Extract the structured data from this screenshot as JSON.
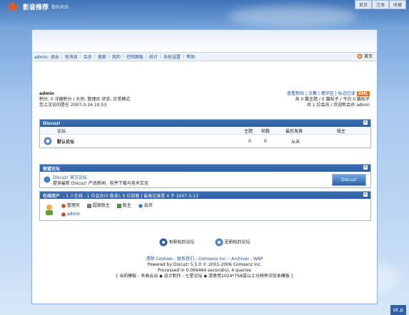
{
  "brand": {
    "title": "影音推荐",
    "subtitle": "数码风尚"
  },
  "top_links": [
    "首页",
    "注册",
    "收藏"
  ],
  "nav": {
    "items": [
      "admin: 退出",
      "短消息",
      "会员",
      "搜索",
      "我的",
      "控制面板",
      "统计",
      "系统设置",
      "帮助"
    ],
    "home": "首页"
  },
  "user": {
    "name": "admin",
    "line1": "积分: 0 详细积分 / 头衔: 管理员 状态: 正常模式",
    "line2": "您上次访问是在 2007-3-16 10:53"
  },
  "links": {
    "row1": "查看新帖 | 文集 | 精华区 | 标记已读",
    "rss": "XML",
    "row2": "共 0 篇主题 / 0 篇帖子 / 今日 0 篇帖子",
    "row3": "共 1 位会员 / 欢迎新会员 admin"
  },
  "forum_box": {
    "title": "Discuz!",
    "columns": {
      "forum": "论坛",
      "topics": "主题",
      "posts": "帖数",
      "last": "最后发表",
      "mods": "版主"
    },
    "rows": [
      {
        "name": "默认论坛",
        "topics": "0",
        "posts": "0",
        "last": "从未",
        "mods": ""
      }
    ]
  },
  "friends_box": {
    "title": "联盟论坛",
    "name": "Discuz! 官方论坛",
    "desc": "提供最新 Discuz! 产品新闻、软件下载与技术交流",
    "logo": "Discuz!"
  },
  "online_box": {
    "title": "在线用户",
    "summary": "- 1 人在线 - 1 位会员(0 隐身), 0 位游客 | 最高记录是 4 于 2007-3-13",
    "legend": [
      "管理员",
      "超级版主",
      "版主",
      "会员"
    ],
    "user": "admin"
  },
  "legend_bottom": {
    "new": "有新帖的论坛",
    "none": "无新帖的论坛"
  },
  "footer": {
    "line1": "清除 Cookies - 联系我们 - Comsenz Inc. - Archiver - WAP",
    "powered": "Powered by Discuz! 5.5.0 © 2001-2006 Comsenz Inc.",
    "processed": "Processed in 0.066464 second(s), 4 queries",
    "line4": "[ 当前模板 - 天高云淡 ◆ 设计制作 - 七星论坛 ◆ 请使用1024*768或以上分辨率浏览本模板 ]"
  },
  "bottom_brand": "sk.p",
  "colors": {
    "accent": "#2f5fa4",
    "link": "#1d4f9c",
    "rss": "#e8711c"
  }
}
